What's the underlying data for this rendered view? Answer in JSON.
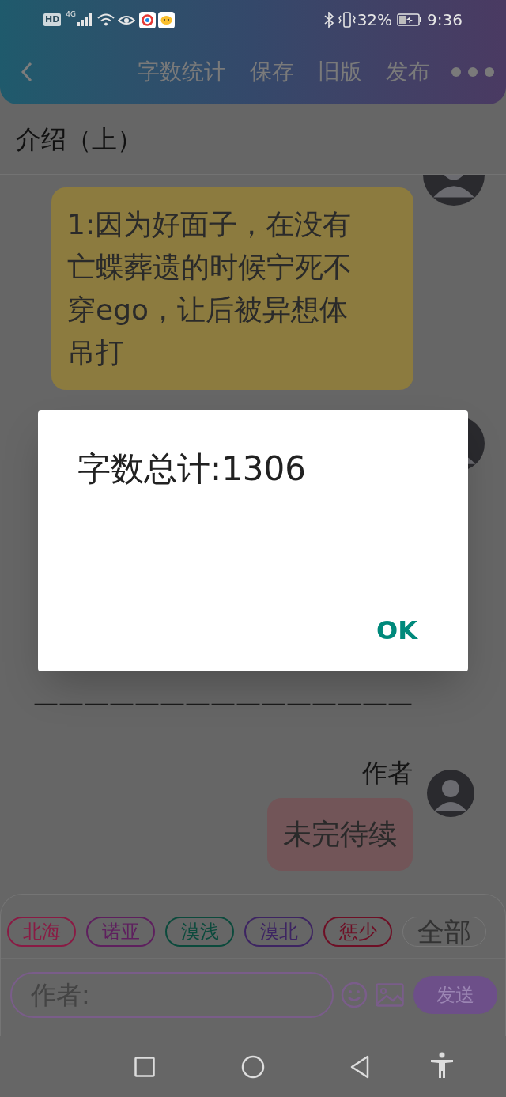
{
  "status_bar": {
    "hd_label": "HD",
    "network": "4G",
    "battery": "32%",
    "time": "9:36"
  },
  "toolbar": {
    "actions": [
      "字数统计",
      "保存",
      "旧版",
      "发布"
    ]
  },
  "page_title": "介绍（上）",
  "messages": [
    {
      "kind": "bubble",
      "text": "1:因为好面子，在没有亡蝶葬遗的时候宁死不穿ego，让后被异想体吊打",
      "color": "#8c7b3f"
    },
    {
      "kind": "obscured"
    },
    {
      "kind": "plain",
      "text": "———————————————"
    },
    {
      "kind": "bubble",
      "sender": "作者",
      "text": "未完待续",
      "color": "#725558"
    }
  ],
  "tags": [
    {
      "kind": "tag",
      "label": "北海",
      "color": "#8a1a44"
    },
    {
      "kind": "tag",
      "label": "诺亚",
      "color": "#5e1f5e"
    },
    {
      "kind": "tag",
      "label": "漠浅",
      "color": "#0b4a3c"
    },
    {
      "kind": "tag",
      "label": "漠北",
      "color": "#3d2462"
    },
    {
      "kind": "tag",
      "label": "惩少",
      "color": "#6e0f25"
    },
    {
      "kind": "all",
      "label": "全部",
      "color": "#777777"
    }
  ],
  "composer": {
    "placeholder": "作者:",
    "send": "发送"
  },
  "dialog": {
    "message": "字数总计:1306",
    "button": "OK"
  }
}
